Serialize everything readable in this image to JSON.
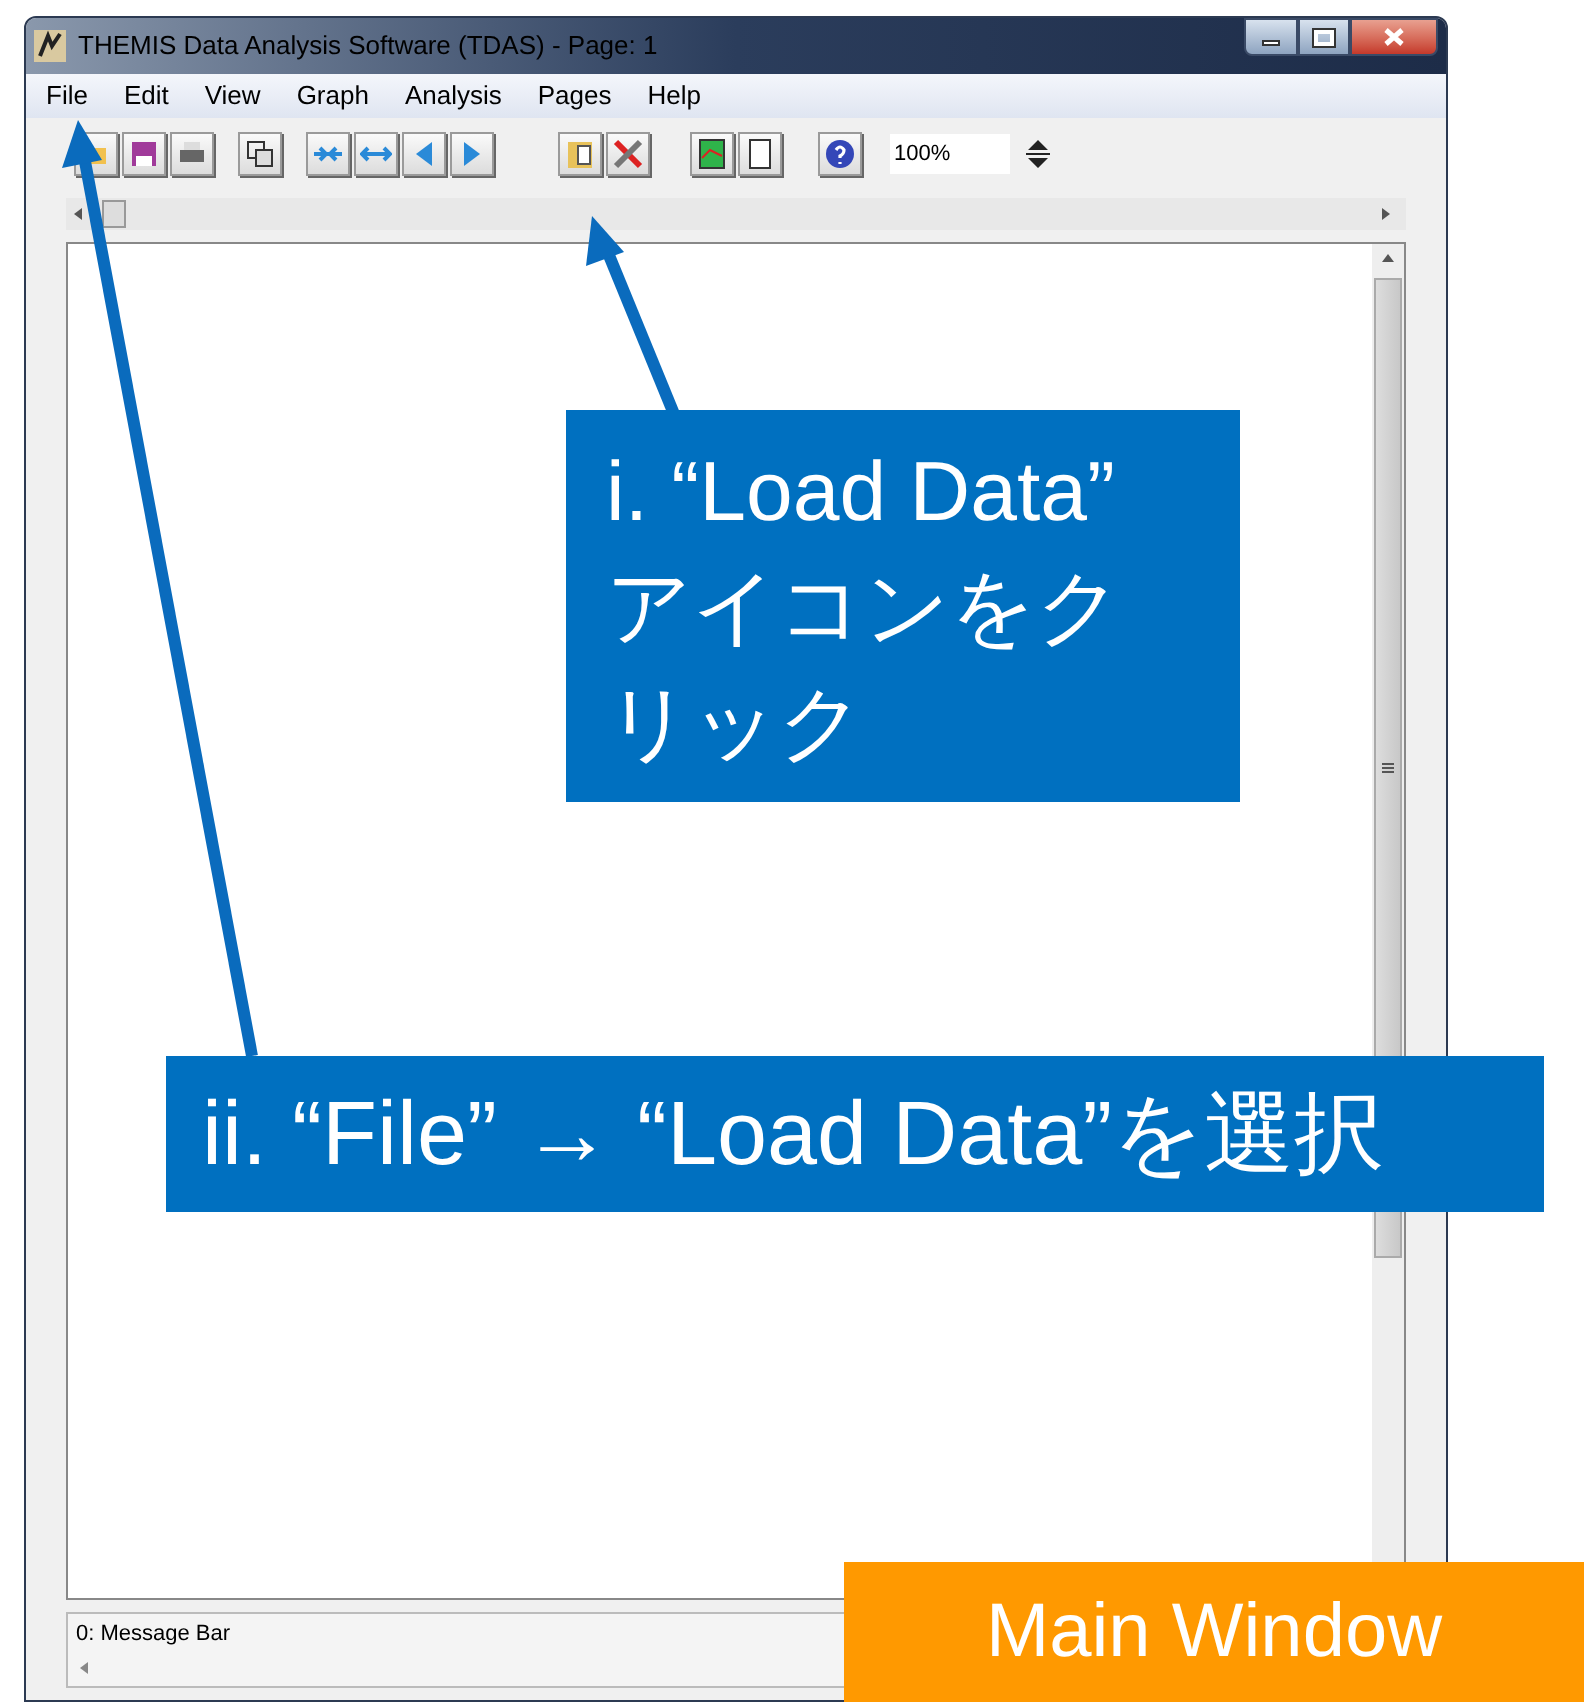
{
  "window": {
    "title": "THEMIS Data Analysis Software (TDAS) - Page: 1"
  },
  "menu": [
    "File",
    "Edit",
    "View",
    "Graph",
    "Analysis",
    "Pages",
    "Help"
  ],
  "toolbar": {
    "zoom_value": "100%"
  },
  "status_bar": {
    "message": "0: Message Bar"
  },
  "callouts": [
    {
      "text": "i. “Load Data” アイコンをクリック"
    },
    {
      "text": "ii. “File” → “Load Data”を選択"
    }
  ],
  "label": "Main Window"
}
